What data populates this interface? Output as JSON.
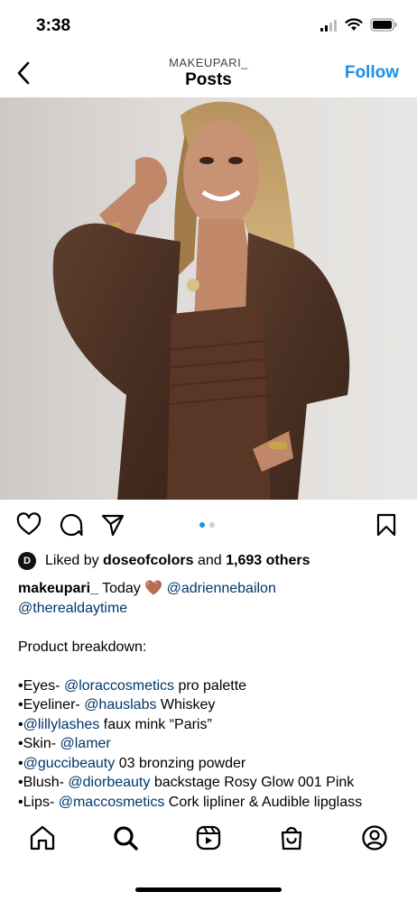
{
  "status": {
    "time": "3:38"
  },
  "header": {
    "username": "MAKEUPARI_",
    "title": "Posts",
    "follow": "Follow"
  },
  "post": {
    "image_alt": "Woman in brown leather blazer posing against a light wall"
  },
  "likes": {
    "avatar": "D",
    "prefix": "Liked by",
    "user": "doseofcolors",
    "middle": "and",
    "others": "1,693 others"
  },
  "caption": {
    "author": "makeupari_",
    "today": "Today",
    "heart": "🤎",
    "mention1": "@adriennebailon",
    "mention2": "@therealdaytime",
    "heading": "Product breakdown:",
    "items": [
      {
        "prefix": "•Eyes- ",
        "tag": "@loraccosmetics",
        "suffix": " pro palette"
      },
      {
        "prefix": "•Eyeliner- ",
        "tag": "@hauslabs",
        "suffix": " Whiskey"
      },
      {
        "prefix": "•",
        "tag": "@lillylashes",
        "suffix": " faux mink “Paris”"
      },
      {
        "prefix": "•Skin- ",
        "tag": "@lamer",
        "suffix": ""
      },
      {
        "prefix": "•",
        "tag": "@guccibeauty",
        "suffix": " 03 bronzing powder"
      },
      {
        "prefix": "•Blush- ",
        "tag": "@diorbeauty",
        "suffix": " backstage Rosy Glow 001 Pink"
      },
      {
        "prefix": "•Lips- ",
        "tag": "@maccosmetics",
        "suffix": " Cork lipliner & Audible lipglass"
      }
    ]
  },
  "carousel": {
    "count": 2,
    "active": 1
  },
  "colors": {
    "accent": "#1a8fe8",
    "mention": "#00376b"
  },
  "icons": [
    "back-icon",
    "heart-icon",
    "comment-icon",
    "share-icon",
    "bookmark-icon",
    "home-icon",
    "search-icon",
    "reels-icon",
    "shop-icon",
    "profile-icon"
  ]
}
